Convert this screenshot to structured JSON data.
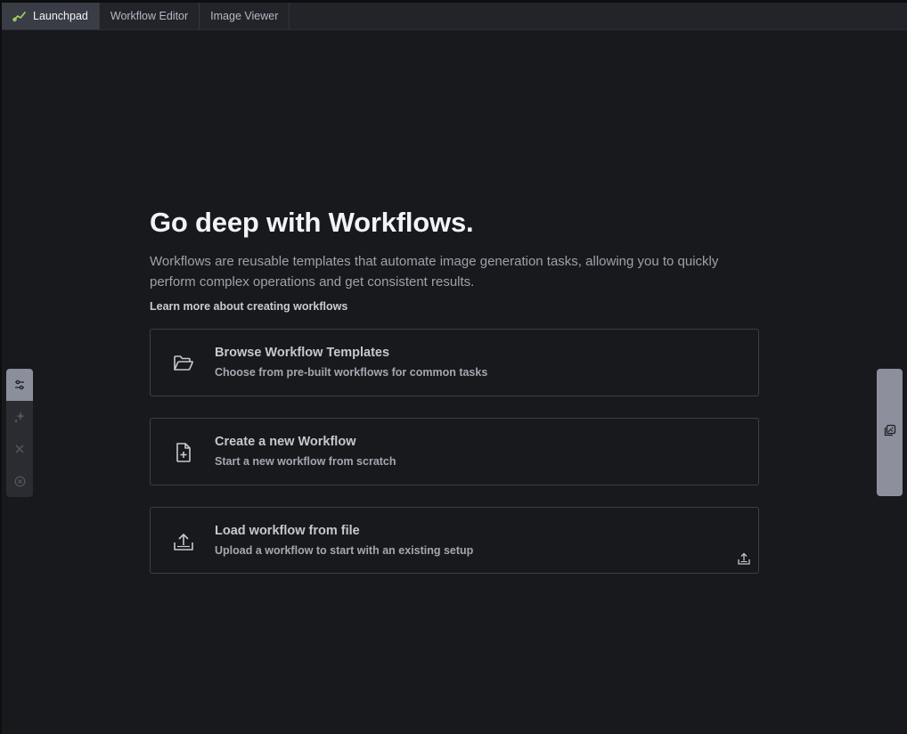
{
  "tabs": [
    {
      "label": "Launchpad",
      "active": true,
      "icon": "chart-line-icon"
    },
    {
      "label": "Workflow Editor",
      "active": false
    },
    {
      "label": "Image Viewer",
      "active": false
    }
  ],
  "main": {
    "heading": "Go deep with Workflows.",
    "description": "Workflows are reusable templates that automate image generation tasks, allowing you to quickly perform complex operations and get consistent results.",
    "learn_more": "Learn more about creating workflows"
  },
  "cards": [
    {
      "title": "Browse Workflow Templates",
      "subtitle": "Choose from pre-built workflows for common tasks",
      "icon": "folder-open-icon"
    },
    {
      "title": "Create a new Workflow",
      "subtitle": "Start a new workflow from scratch",
      "icon": "file-plus-icon"
    },
    {
      "title": "Load workflow from file",
      "subtitle": "Upload a workflow to start with an existing setup",
      "icon": "upload-icon"
    }
  ],
  "left_toolbar": {
    "items": [
      {
        "icon": "sliders-icon",
        "active": true
      },
      {
        "icon": "sparkle-icon",
        "active": false
      },
      {
        "icon": "close-icon",
        "active": false
      },
      {
        "icon": "cancel-circle-icon",
        "active": false
      }
    ]
  },
  "right_toolbar": {
    "icon": "images-icon"
  },
  "colors": {
    "background": "#18191d",
    "tabbar": "#22242a",
    "tab_active": "#3a3d45",
    "accent_green": "#a8d65b",
    "card_border": "#3c3f47"
  }
}
